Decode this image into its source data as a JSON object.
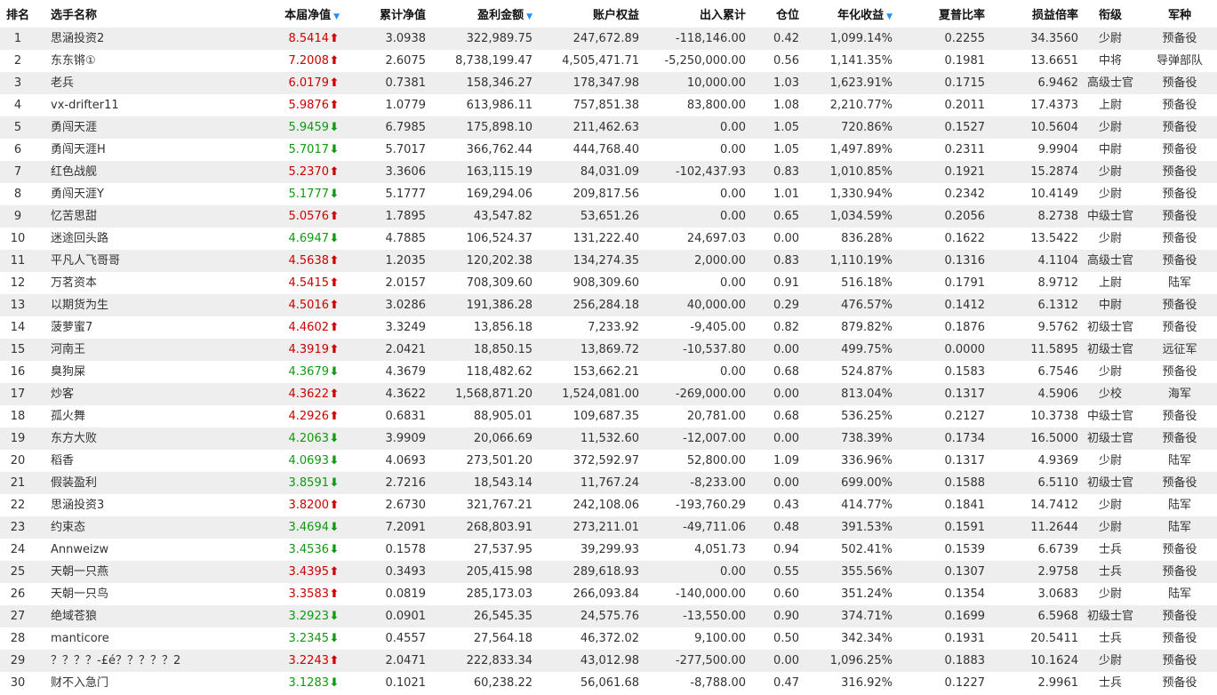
{
  "colors": {
    "up": "#cc0000",
    "down": "#119911",
    "sort": "#1e90ff",
    "row_alt": "#eeeeee"
  },
  "headers": {
    "rank": "排名",
    "name": "选手名称",
    "nav": "本届净值",
    "cum_nav": "累计净值",
    "profit": "盈利金额",
    "equity": "账户权益",
    "flow": "出入累计",
    "position": "仓位",
    "annual": "年化收益",
    "sharpe": "夏普比率",
    "pl_ratio": "损益倍率",
    "title": "衔级",
    "branch": "军种"
  },
  "sortable_icon": "sort-down-icon",
  "rows": [
    {
      "rank": "1",
      "name": "思涵投资2",
      "nav": "8.5414",
      "dir": "up",
      "cum_nav": "3.0938",
      "profit": "322,989.75",
      "equity": "247,672.89",
      "flow": "-118,146.00",
      "position": "0.42",
      "annual": "1,099.14%",
      "sharpe": "0.2255",
      "pl_ratio": "34.3560",
      "title": "少尉",
      "branch": "预备役"
    },
    {
      "rank": "2",
      "name": "东东锵①",
      "nav": "7.2008",
      "dir": "up",
      "cum_nav": "2.6075",
      "profit": "8,738,199.47",
      "equity": "4,505,471.71",
      "flow": "-5,250,000.00",
      "position": "0.56",
      "annual": "1,141.35%",
      "sharpe": "0.1981",
      "pl_ratio": "13.6651",
      "title": "中将",
      "branch": "导弹部队"
    },
    {
      "rank": "3",
      "name": "老兵",
      "nav": "6.0179",
      "dir": "up",
      "cum_nav": "0.7381",
      "profit": "158,346.27",
      "equity": "178,347.98",
      "flow": "10,000.00",
      "position": "1.03",
      "annual": "1,623.91%",
      "sharpe": "0.1715",
      "pl_ratio": "6.9462",
      "title": "高级士官",
      "branch": "预备役"
    },
    {
      "rank": "4",
      "name": "vx-drifter11",
      "nav": "5.9876",
      "dir": "up",
      "cum_nav": "1.0779",
      "profit": "613,986.11",
      "equity": "757,851.38",
      "flow": "83,800.00",
      "position": "1.08",
      "annual": "2,210.77%",
      "sharpe": "0.2011",
      "pl_ratio": "17.4373",
      "title": "上尉",
      "branch": "预备役"
    },
    {
      "rank": "5",
      "name": "勇闯天涯",
      "nav": "5.9459",
      "dir": "down",
      "cum_nav": "6.7985",
      "profit": "175,898.10",
      "equity": "211,462.63",
      "flow": "0.00",
      "position": "1.05",
      "annual": "720.86%",
      "sharpe": "0.1527",
      "pl_ratio": "10.5604",
      "title": "少尉",
      "branch": "预备役"
    },
    {
      "rank": "6",
      "name": "勇闯天涯H",
      "nav": "5.7017",
      "dir": "down",
      "cum_nav": "5.7017",
      "profit": "366,762.44",
      "equity": "444,768.40",
      "flow": "0.00",
      "position": "1.05",
      "annual": "1,497.89%",
      "sharpe": "0.2311",
      "pl_ratio": "9.9904",
      "title": "中尉",
      "branch": "预备役"
    },
    {
      "rank": "7",
      "name": "红色战舰",
      "nav": "5.2370",
      "dir": "up",
      "cum_nav": "3.3606",
      "profit": "163,115.19",
      "equity": "84,031.09",
      "flow": "-102,437.93",
      "position": "0.83",
      "annual": "1,010.85%",
      "sharpe": "0.1921",
      "pl_ratio": "15.2874",
      "title": "少尉",
      "branch": "预备役"
    },
    {
      "rank": "8",
      "name": "勇闯天涯Y",
      "nav": "5.1777",
      "dir": "down",
      "cum_nav": "5.1777",
      "profit": "169,294.06",
      "equity": "209,817.56",
      "flow": "0.00",
      "position": "1.01",
      "annual": "1,330.94%",
      "sharpe": "0.2342",
      "pl_ratio": "10.4149",
      "title": "少尉",
      "branch": "预备役"
    },
    {
      "rank": "9",
      "name": "忆苦思甜",
      "nav": "5.0576",
      "dir": "up",
      "cum_nav": "1.7895",
      "profit": "43,547.82",
      "equity": "53,651.26",
      "flow": "0.00",
      "position": "0.65",
      "annual": "1,034.59%",
      "sharpe": "0.2056",
      "pl_ratio": "8.2738",
      "title": "中级士官",
      "branch": "预备役"
    },
    {
      "rank": "10",
      "name": "迷途回头路",
      "nav": "4.6947",
      "dir": "down",
      "cum_nav": "4.7885",
      "profit": "106,524.37",
      "equity": "131,222.40",
      "flow": "24,697.03",
      "position": "0.00",
      "annual": "836.28%",
      "sharpe": "0.1622",
      "pl_ratio": "13.5422",
      "title": "少尉",
      "branch": "预备役"
    },
    {
      "rank": "11",
      "name": "平凡人飞哥哥",
      "nav": "4.5638",
      "dir": "up",
      "cum_nav": "1.2035",
      "profit": "120,202.38",
      "equity": "134,274.35",
      "flow": "2,000.00",
      "position": "0.83",
      "annual": "1,110.19%",
      "sharpe": "0.1316",
      "pl_ratio": "4.1104",
      "title": "高级士官",
      "branch": "预备役"
    },
    {
      "rank": "12",
      "name": "万茗资本",
      "nav": "4.5415",
      "dir": "up",
      "cum_nav": "2.0157",
      "profit": "708,309.60",
      "equity": "908,309.60",
      "flow": "0.00",
      "position": "0.91",
      "annual": "516.18%",
      "sharpe": "0.1791",
      "pl_ratio": "8.9712",
      "title": "上尉",
      "branch": "陆军"
    },
    {
      "rank": "13",
      "name": "以期货为生",
      "nav": "4.5016",
      "dir": "up",
      "cum_nav": "3.0286",
      "profit": "191,386.28",
      "equity": "256,284.18",
      "flow": "40,000.00",
      "position": "0.29",
      "annual": "476.57%",
      "sharpe": "0.1412",
      "pl_ratio": "6.1312",
      "title": "中尉",
      "branch": "预备役"
    },
    {
      "rank": "14",
      "name": "菠萝蜜7",
      "nav": "4.4602",
      "dir": "up",
      "cum_nav": "3.3249",
      "profit": "13,856.18",
      "equity": "7,233.92",
      "flow": "-9,405.00",
      "position": "0.82",
      "annual": "879.82%",
      "sharpe": "0.1876",
      "pl_ratio": "9.5762",
      "title": "初级士官",
      "branch": "预备役"
    },
    {
      "rank": "15",
      "name": "河南王",
      "nav": "4.3919",
      "dir": "up",
      "cum_nav": "2.0421",
      "profit": "18,850.15",
      "equity": "13,869.72",
      "flow": "-10,537.80",
      "position": "0.00",
      "annual": "499.75%",
      "sharpe": "0.0000",
      "pl_ratio": "11.5895",
      "title": "初级士官",
      "branch": "远征军"
    },
    {
      "rank": "16",
      "name": "臭狗屎",
      "nav": "4.3679",
      "dir": "down",
      "cum_nav": "4.3679",
      "profit": "118,482.62",
      "equity": "153,662.21",
      "flow": "0.00",
      "position": "0.68",
      "annual": "524.87%",
      "sharpe": "0.1583",
      "pl_ratio": "6.7546",
      "title": "少尉",
      "branch": "预备役"
    },
    {
      "rank": "17",
      "name": "炒客",
      "nav": "4.3622",
      "dir": "up",
      "cum_nav": "4.3622",
      "profit": "1,568,871.20",
      "equity": "1,524,081.00",
      "flow": "-269,000.00",
      "position": "0.00",
      "annual": "813.04%",
      "sharpe": "0.1317",
      "pl_ratio": "4.5906",
      "title": "少校",
      "branch": "海军"
    },
    {
      "rank": "18",
      "name": "孤火舞",
      "nav": "4.2926",
      "dir": "up",
      "cum_nav": "0.6831",
      "profit": "88,905.01",
      "equity": "109,687.35",
      "flow": "20,781.00",
      "position": "0.68",
      "annual": "536.25%",
      "sharpe": "0.2127",
      "pl_ratio": "10.3738",
      "title": "中级士官",
      "branch": "预备役"
    },
    {
      "rank": "19",
      "name": "东方大败",
      "nav": "4.2063",
      "dir": "down",
      "cum_nav": "3.9909",
      "profit": "20,066.69",
      "equity": "11,532.60",
      "flow": "-12,007.00",
      "position": "0.00",
      "annual": "738.39%",
      "sharpe": "0.1734",
      "pl_ratio": "16.5000",
      "title": "初级士官",
      "branch": "预备役"
    },
    {
      "rank": "20",
      "name": "稻香",
      "nav": "4.0693",
      "dir": "down",
      "cum_nav": "4.0693",
      "profit": "273,501.20",
      "equity": "372,592.97",
      "flow": "52,800.00",
      "position": "1.09",
      "annual": "336.96%",
      "sharpe": "0.1317",
      "pl_ratio": "4.9369",
      "title": "少尉",
      "branch": "陆军"
    },
    {
      "rank": "21",
      "name": "假装盈利",
      "nav": "3.8591",
      "dir": "down",
      "cum_nav": "2.7216",
      "profit": "18,543.14",
      "equity": "11,767.24",
      "flow": "-8,233.00",
      "position": "0.00",
      "annual": "699.00%",
      "sharpe": "0.1588",
      "pl_ratio": "6.5110",
      "title": "初级士官",
      "branch": "预备役"
    },
    {
      "rank": "22",
      "name": "思涵投资3",
      "nav": "3.8200",
      "dir": "up",
      "cum_nav": "2.6730",
      "profit": "321,767.21",
      "equity": "242,108.06",
      "flow": "-193,760.29",
      "position": "0.43",
      "annual": "414.77%",
      "sharpe": "0.1841",
      "pl_ratio": "14.7412",
      "title": "少尉",
      "branch": "陆军"
    },
    {
      "rank": "23",
      "name": "约束态",
      "nav": "3.4694",
      "dir": "down",
      "cum_nav": "7.2091",
      "profit": "268,803.91",
      "equity": "273,211.01",
      "flow": "-49,711.06",
      "position": "0.48",
      "annual": "391.53%",
      "sharpe": "0.1591",
      "pl_ratio": "11.2644",
      "title": "少尉",
      "branch": "陆军"
    },
    {
      "rank": "24",
      "name": "Annweizw",
      "nav": "3.4536",
      "dir": "down",
      "cum_nav": "0.1578",
      "profit": "27,537.95",
      "equity": "39,299.93",
      "flow": "4,051.73",
      "position": "0.94",
      "annual": "502.41%",
      "sharpe": "0.1539",
      "pl_ratio": "6.6739",
      "title": "士兵",
      "branch": "预备役"
    },
    {
      "rank": "25",
      "name": "天朝一只燕",
      "nav": "3.4395",
      "dir": "up",
      "cum_nav": "0.3493",
      "profit": "205,415.98",
      "equity": "289,618.93",
      "flow": "0.00",
      "position": "0.55",
      "annual": "355.56%",
      "sharpe": "0.1307",
      "pl_ratio": "2.9758",
      "title": "士兵",
      "branch": "预备役"
    },
    {
      "rank": "26",
      "name": "天朝一只鸟",
      "nav": "3.3583",
      "dir": "up",
      "cum_nav": "0.0819",
      "profit": "285,173.03",
      "equity": "266,093.84",
      "flow": "-140,000.00",
      "position": "0.60",
      "annual": "351.24%",
      "sharpe": "0.1354",
      "pl_ratio": "3.0683",
      "title": "少尉",
      "branch": "陆军"
    },
    {
      "rank": "27",
      "name": "绝域苍狼",
      "nav": "3.2923",
      "dir": "down",
      "cum_nav": "0.0901",
      "profit": "26,545.35",
      "equity": "24,575.76",
      "flow": "-13,550.00",
      "position": "0.90",
      "annual": "374.71%",
      "sharpe": "0.1699",
      "pl_ratio": "6.5968",
      "title": "初级士官",
      "branch": "预备役"
    },
    {
      "rank": "28",
      "name": "manticore",
      "nav": "3.2345",
      "dir": "down",
      "cum_nav": "0.4557",
      "profit": "27,564.18",
      "equity": "46,372.02",
      "flow": "9,100.00",
      "position": "0.50",
      "annual": "342.34%",
      "sharpe": "0.1931",
      "pl_ratio": "20.5411",
      "title": "士兵",
      "branch": "预备役"
    },
    {
      "rank": "29",
      "name": "？？？？-£é？？？？？2",
      "nav": "3.2243",
      "dir": "up",
      "cum_nav": "2.0471",
      "profit": "222,833.34",
      "equity": "43,012.98",
      "flow": "-277,500.00",
      "position": "0.00",
      "annual": "1,096.25%",
      "sharpe": "0.1883",
      "pl_ratio": "10.1624",
      "title": "少尉",
      "branch": "预备役"
    },
    {
      "rank": "30",
      "name": "财不入急门",
      "nav": "3.1283",
      "dir": "down",
      "cum_nav": "0.1021",
      "profit": "60,238.22",
      "equity": "56,061.68",
      "flow": "-8,788.00",
      "position": "0.47",
      "annual": "316.92%",
      "sharpe": "0.1227",
      "pl_ratio": "2.9961",
      "title": "士兵",
      "branch": "预备役"
    }
  ]
}
